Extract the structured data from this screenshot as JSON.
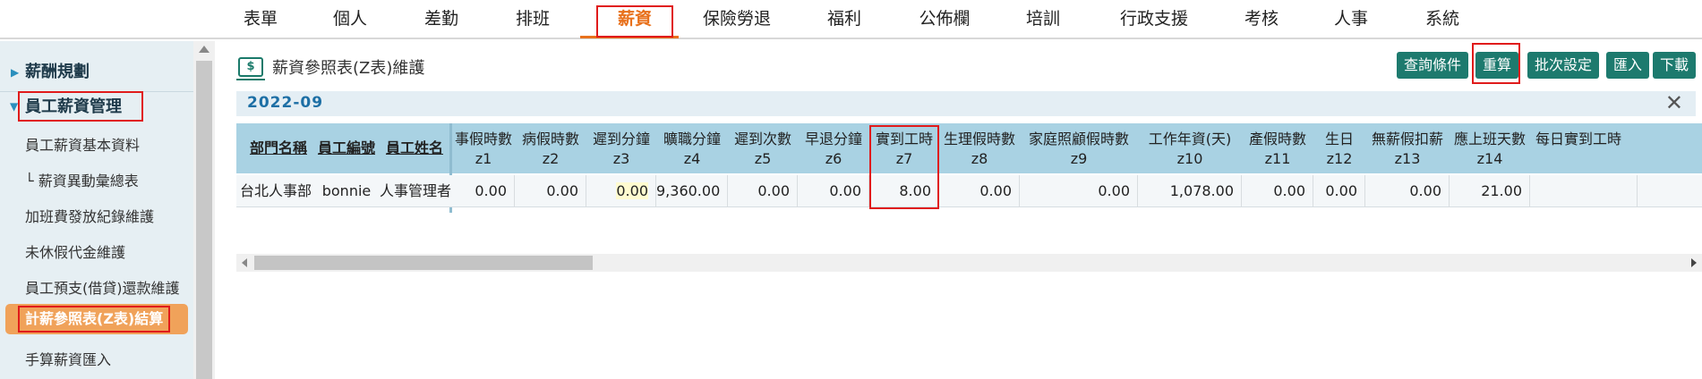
{
  "nav": {
    "items": [
      "表單",
      "個人",
      "差勤",
      "排班",
      "薪資",
      "保險勞退",
      "福利",
      "公佈欄",
      "培訓",
      "行政支援",
      "考核",
      "人事",
      "系統"
    ],
    "active_index": 4,
    "accent_color": "#e8711c"
  },
  "sidebar": {
    "groups": [
      {
        "label": "薪酬規劃",
        "expanded": false
      },
      {
        "label": "員工薪資管理",
        "expanded": true
      }
    ],
    "items": [
      "員工薪資基本資料",
      "└ 薪資異動彙總表",
      "加班費發放紀錄維護",
      "未休假代金維護",
      "員工預支(借貸)還款維護",
      "計薪參照表(Z表)結算",
      "手算薪資匯入"
    ],
    "active_index": 5
  },
  "main": {
    "title_icon": "$",
    "title": "薪資參照表(Z表)維護",
    "buttons": {
      "query": "查詢條件",
      "recalc": "重算",
      "batch": "批次設定",
      "import": "匯入",
      "download": "下載"
    },
    "period": "2022-09",
    "close_glyph": "✕"
  },
  "grid": {
    "fixed_headers": [
      "部門名稱",
      "員工編號",
      "員工姓名"
    ],
    "columns": [
      {
        "label": "事假時數",
        "code": "z1"
      },
      {
        "label": "病假時數",
        "code": "z2"
      },
      {
        "label": "遲到分鐘",
        "code": "z3"
      },
      {
        "label": "曠職分鐘",
        "code": "z4"
      },
      {
        "label": "遲到次數",
        "code": "z5"
      },
      {
        "label": "早退分鐘",
        "code": "z6"
      },
      {
        "label": "實到工時",
        "code": "z7"
      },
      {
        "label": "生理假時數",
        "code": "z8"
      },
      {
        "label": "家庭照顧假時數",
        "code": "z9"
      },
      {
        "label": "工作年資(天)",
        "code": "z10"
      },
      {
        "label": "產假時數",
        "code": "z11"
      },
      {
        "label": "生日",
        "code": "z12"
      },
      {
        "label": "無薪假扣薪",
        "code": "z13"
      },
      {
        "label": "應上班天數",
        "code": "z14"
      },
      {
        "label": "每日實到工時",
        "code": ""
      }
    ],
    "row": {
      "dept": "台北人事部",
      "emp_id": "bonnie",
      "emp_name": "人事管理者",
      "values": [
        "0.00",
        "0.00",
        "0.00",
        "9,360.00",
        "0.00",
        "0.00",
        "8.00",
        "0.00",
        "0.00",
        "1,078.00",
        "0.00",
        "0.00",
        "0.00",
        "21.00",
        ""
      ]
    }
  }
}
